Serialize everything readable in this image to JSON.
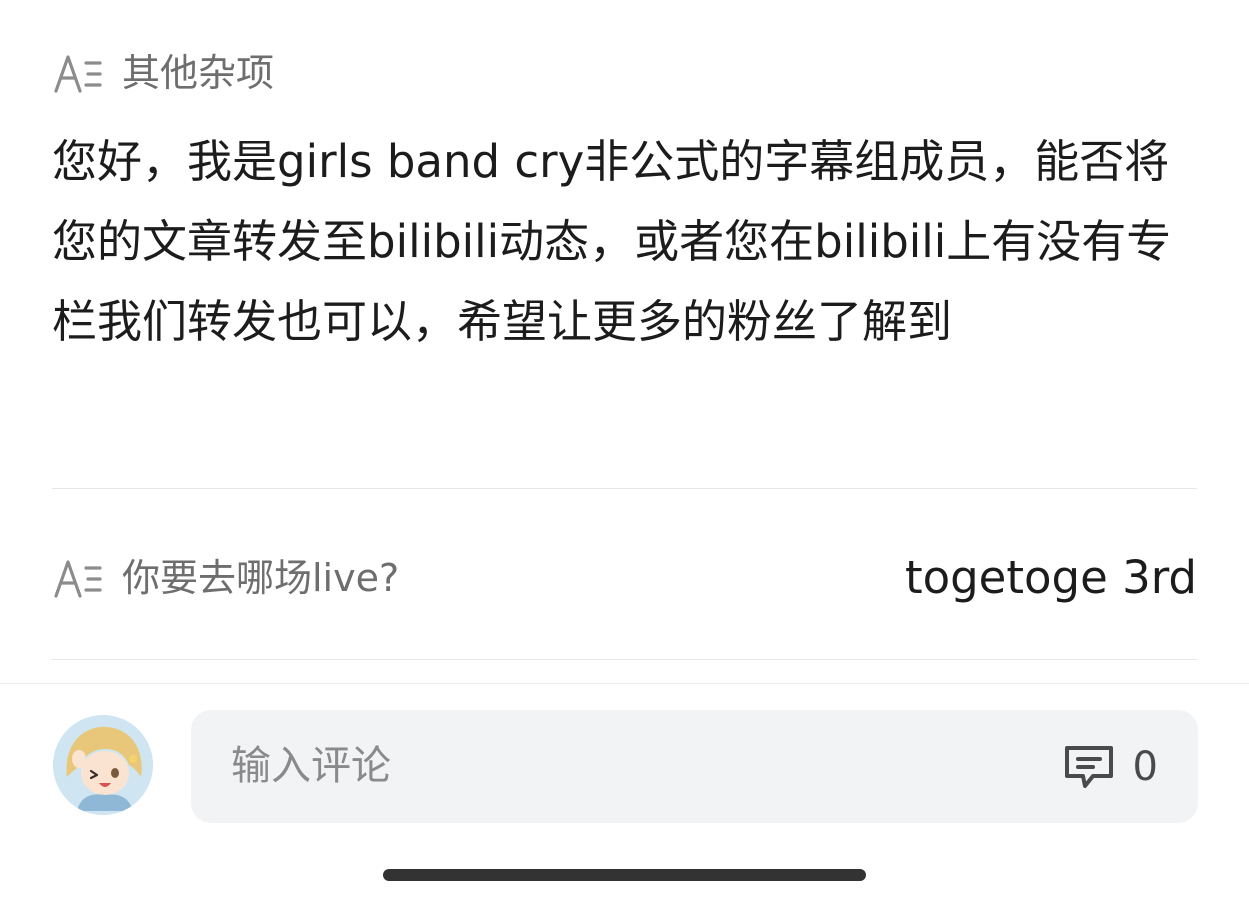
{
  "fields": [
    {
      "icon": "text-field-icon",
      "label": "其他杂项",
      "answer": "您好，我是girls band cry非公式的字幕组成员，能否将您的文章转发至bilibili动态，或者您在bilibili上有没有专栏我们转发也可以，希望让更多的粉丝了解到"
    },
    {
      "icon": "text-field-icon",
      "label": "你要去哪场live?",
      "answer": "togetoge 3rd"
    }
  ],
  "comment_bar": {
    "placeholder": "输入评论",
    "comment_icon": "comment-icon",
    "count": "0"
  },
  "colors": {
    "label_gray": "#6e6e6e",
    "text_dark": "#1c1c1c",
    "input_bg": "#f2f3f5",
    "home_indicator": "#333333"
  }
}
